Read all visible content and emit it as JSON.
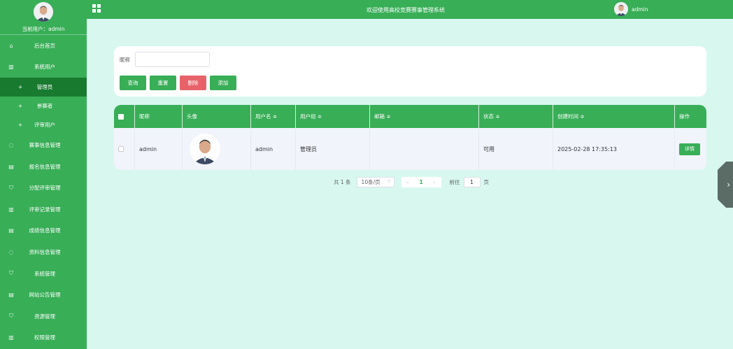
{
  "app": {
    "title": "欢迎使用高校竞赛赛事管理系统"
  },
  "top_user": {
    "name": "admin"
  },
  "sidebar": {
    "current_user_label": "当前用户：admin",
    "items": [
      {
        "label": "后台首页",
        "icon": "home-icon"
      },
      {
        "label": "系统用户",
        "icon": "columns-icon"
      },
      {
        "label": "管理员",
        "sub": true,
        "active": true
      },
      {
        "label": "参赛者",
        "sub": true
      },
      {
        "label": "评审用户",
        "sub": true
      },
      {
        "label": "赛事信息管理",
        "icon": "chat-icon"
      },
      {
        "label": "报名信息管理",
        "icon": "document-icon"
      },
      {
        "label": "分配评审管理",
        "icon": "shield-icon"
      },
      {
        "label": "评审记录管理",
        "icon": "columns-icon"
      },
      {
        "label": "成绩信息管理",
        "icon": "document-icon"
      },
      {
        "label": "资料信息管理",
        "icon": "chat-icon"
      },
      {
        "label": "系统管理",
        "icon": "shield-icon"
      },
      {
        "label": "网站公告管理",
        "icon": "document-icon"
      },
      {
        "label": "资源管理",
        "icon": "shield-icon"
      },
      {
        "label": "权限管理",
        "icon": "columns-icon"
      }
    ]
  },
  "search": {
    "nickname_label": "昵称",
    "nickname_value": "",
    "buttons": {
      "query": "查询",
      "reset": "重置",
      "delete": "删除",
      "add": "添加"
    }
  },
  "table": {
    "columns": [
      "昵称",
      "头像",
      "用户名 ≑",
      "用户组 ≑",
      "邮箱 ≑",
      "状态 ≑",
      "创建时间 ≑",
      "操作"
    ],
    "rows": [
      {
        "nickname": "admin",
        "username": "admin",
        "group": "管理员",
        "email": "",
        "status": "可用",
        "created": "2025-02-28 17:35:13",
        "action": "详情"
      }
    ]
  },
  "pagination": {
    "total": "共 1 条",
    "page_size": "10条/页",
    "current_page": "1",
    "goto_label": "前往",
    "goto_value": "1",
    "page_unit": "页"
  },
  "colors": {
    "brand": "#38ae57",
    "brand_dark": "#187a2f",
    "danger": "#e8626a",
    "background": "#d8f8ef"
  }
}
